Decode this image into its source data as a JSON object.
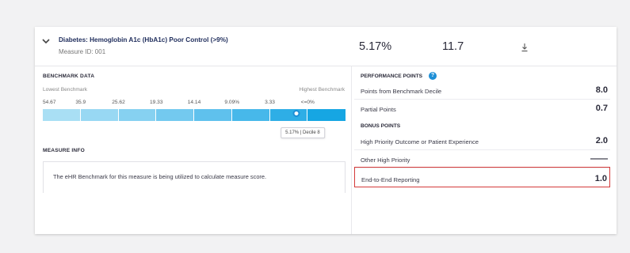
{
  "measure": {
    "title": "Diabetes: Hemoglobin A1c (HbA1c) Poor Control (>9%)",
    "id_label": "Measure ID: 001",
    "value_1": "5.17%",
    "value_2": "11.7"
  },
  "benchmark": {
    "section_label": "BENCHMARK DATA",
    "lowest_label": "Lowest Benchmark",
    "highest_label": "Highest Benchmark",
    "ticks": [
      "54.67",
      "35.9",
      "25.62",
      "19.33",
      "14.14",
      "9.09%",
      "3.33",
      "<=0%"
    ],
    "segment_colors": [
      "#a9dff4",
      "#98d8f3",
      "#86d1f1",
      "#73c9ef",
      "#5fc1ed",
      "#47b8ea",
      "#2eaee6",
      "#16a6e3"
    ],
    "marker_decile": 8,
    "tooltip": "5.17% | Decile 8"
  },
  "measure_info": {
    "section_label": "MEASURE INFO",
    "text": "The eHR Benchmark for this measure is being utilized to calculate measure score."
  },
  "performance": {
    "title": "PERFORMANCE POINTS",
    "help_icon": "?",
    "rows": [
      {
        "label": "Points from Benchmark Decile",
        "value": "8.0"
      },
      {
        "label": "Partial Points",
        "value": "0.7"
      }
    ],
    "bonus_label": "BONUS POINTS",
    "bonus_rows": [
      {
        "label": "High Priority Outcome or Patient Experience",
        "value": "2.0"
      },
      {
        "label": "Other High Priority",
        "value": "——"
      },
      {
        "label": "End-to-End Reporting",
        "value": "1.0"
      }
    ]
  },
  "icons": {
    "expand": "chevron-down-icon",
    "download": "download-icon",
    "help": "help-circle-icon"
  },
  "colors": {
    "accent": "#1e8fd6",
    "highlight_border": "#d43a3a",
    "title_navy": "#1f2d5c"
  }
}
